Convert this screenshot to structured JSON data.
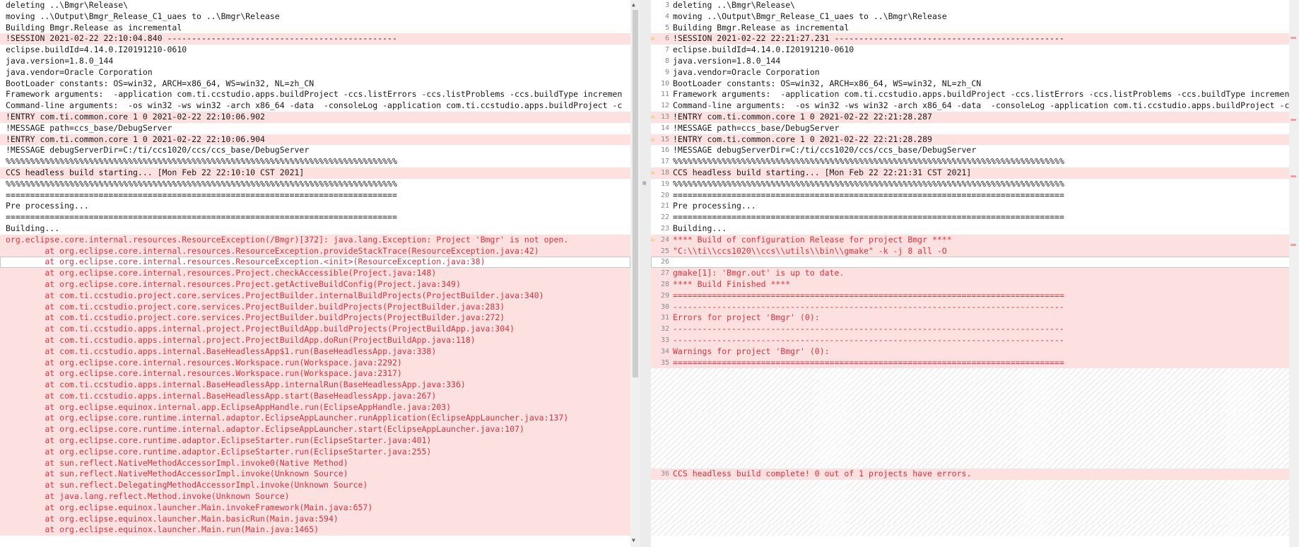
{
  "left_pane": {
    "lines": [
      {
        "text": "deleting ..\\Bmgr\\Release\\",
        "diff": false
      },
      {
        "text": "moving ..\\Output\\Bmgr_Release_C1_uaes to ..\\Bmgr\\Release",
        "diff": false
      },
      {
        "text": "Building Bmgr.Release as incremental",
        "diff": false
      },
      {
        "text": "!SESSION 2021-02-22 22:10:04.840 -----------------------------------------------",
        "diff": true
      },
      {
        "text": "eclipse.buildId=4.14.0.I20191210-0610",
        "diff": false
      },
      {
        "text": "java.version=1.8.0_144",
        "diff": false
      },
      {
        "text": "java.vendor=Oracle Corporation",
        "diff": false
      },
      {
        "text": "BootLoader constants: OS=win32, ARCH=x86_64, WS=win32, NL=zh_CN",
        "diff": false
      },
      {
        "text": "Framework arguments:  -application com.ti.ccstudio.apps.buildProject -ccs.listErrors -ccs.listProblems -ccs.buildType incremen",
        "diff": false
      },
      {
        "text": "Command-line arguments:  -os win32 -ws win32 -arch x86_64 -data  -consoleLog -application com.ti.ccstudio.apps.buildProject -c",
        "diff": false
      },
      {
        "text": "!ENTRY com.ti.common.core 1 0 2021-02-22 22:10:06.902",
        "diff": true
      },
      {
        "text": "!MESSAGE path=ccs_base/DebugServer",
        "diff": false
      },
      {
        "text": "!ENTRY com.ti.common.core 1 0 2021-02-22 22:10:06.904",
        "diff": true
      },
      {
        "text": "!MESSAGE debugServerDir=C:/ti/ccs1020/ccs/ccs_base/DebugServer",
        "diff": false
      },
      {
        "text": "%%%%%%%%%%%%%%%%%%%%%%%%%%%%%%%%%%%%%%%%%%%%%%%%%%%%%%%%%%%%%%%%%%%%%%%%%%%%%%%%",
        "diff": false
      },
      {
        "text": "CCS headless build starting... [Mon Feb 22 22:10:10 CST 2021]",
        "diff": true
      },
      {
        "text": "%%%%%%%%%%%%%%%%%%%%%%%%%%%%%%%%%%%%%%%%%%%%%%%%%%%%%%%%%%%%%%%%%%%%%%%%%%%%%%%%",
        "diff": false
      },
      {
        "text": "================================================================================",
        "diff": false
      },
      {
        "text": "Pre processing...",
        "diff": false
      },
      {
        "text": "================================================================================",
        "diff": false
      },
      {
        "text": "Building...",
        "diff": false
      },
      {
        "text": "org.eclipse.core.internal.resources.ResourceException(/Bmgr)[372]: java.lang.Exception: Project 'Bmgr' is not open.",
        "diff": true,
        "red": true
      },
      {
        "text": "\tat org.eclipse.core.internal.resources.ResourceException.provideStackTrace(ResourceException.java:42)",
        "diff": true,
        "red": true
      },
      {
        "text": "\tat org.eclipse.core.internal.resources.ResourceException.<init>(ResourceException.java:38)",
        "diff": false,
        "red": true,
        "cursor": true
      },
      {
        "text": "\tat org.eclipse.core.internal.resources.Project.checkAccessible(Project.java:148)",
        "diff": true,
        "red": true
      },
      {
        "text": "\tat org.eclipse.core.internal.resources.Project.getActiveBuildConfig(Project.java:349)",
        "diff": true,
        "red": true
      },
      {
        "text": "\tat com.ti.ccstudio.project.core.services.ProjectBuilder.internalBuildProjects(ProjectBuilder.java:340)",
        "diff": true,
        "red": true
      },
      {
        "text": "\tat com.ti.ccstudio.project.core.services.ProjectBuilder.buildProjects(ProjectBuilder.java:283)",
        "diff": true,
        "red": true
      },
      {
        "text": "\tat com.ti.ccstudio.project.core.services.ProjectBuilder.buildProjects(ProjectBuilder.java:272)",
        "diff": true,
        "red": true
      },
      {
        "text": "\tat com.ti.ccstudio.apps.internal.project.ProjectBuildApp.buildProjects(ProjectBuildApp.java:304)",
        "diff": true,
        "red": true
      },
      {
        "text": "\tat com.ti.ccstudio.apps.internal.project.ProjectBuildApp.doRun(ProjectBuildApp.java:118)",
        "diff": true,
        "red": true
      },
      {
        "text": "\tat com.ti.ccstudio.apps.internal.BaseHeadlessApp$1.run(BaseHeadlessApp.java:338)",
        "diff": true,
        "red": true
      },
      {
        "text": "\tat org.eclipse.core.internal.resources.Workspace.run(Workspace.java:2292)",
        "diff": true,
        "red": true
      },
      {
        "text": "\tat org.eclipse.core.internal.resources.Workspace.run(Workspace.java:2317)",
        "diff": true,
        "red": true
      },
      {
        "text": "\tat com.ti.ccstudio.apps.internal.BaseHeadlessApp.internalRun(BaseHeadlessApp.java:336)",
        "diff": true,
        "red": true
      },
      {
        "text": "\tat com.ti.ccstudio.apps.internal.BaseHeadlessApp.start(BaseHeadlessApp.java:267)",
        "diff": true,
        "red": true
      },
      {
        "text": "\tat org.eclipse.equinox.internal.app.EclipseAppHandle.run(EclipseAppHandle.java:203)",
        "diff": true,
        "red": true
      },
      {
        "text": "\tat org.eclipse.core.runtime.internal.adaptor.EclipseAppLauncher.runApplication(EclipseAppLauncher.java:137)",
        "diff": true,
        "red": true
      },
      {
        "text": "\tat org.eclipse.core.runtime.internal.adaptor.EclipseAppLauncher.start(EclipseAppLauncher.java:107)",
        "diff": true,
        "red": true
      },
      {
        "text": "\tat org.eclipse.core.runtime.adaptor.EclipseStarter.run(EclipseStarter.java:401)",
        "diff": true,
        "red": true
      },
      {
        "text": "\tat org.eclipse.core.runtime.adaptor.EclipseStarter.run(EclipseStarter.java:255)",
        "diff": true,
        "red": true
      },
      {
        "text": "\tat sun.reflect.NativeMethodAccessorImpl.invoke0(Native Method)",
        "diff": true,
        "red": true
      },
      {
        "text": "\tat sun.reflect.NativeMethodAccessorImpl.invoke(Unknown Source)",
        "diff": true,
        "red": true
      },
      {
        "text": "\tat sun.reflect.DelegatingMethodAccessorImpl.invoke(Unknown Source)",
        "diff": true,
        "red": true
      },
      {
        "text": "\tat java.lang.reflect.Method.invoke(Unknown Source)",
        "diff": true,
        "red": true
      },
      {
        "text": "\tat org.eclipse.equinox.launcher.Main.invokeFramework(Main.java:657)",
        "diff": true,
        "red": true
      },
      {
        "text": "\tat org.eclipse.equinox.launcher.Main.basicRun(Main.java:594)",
        "diff": true,
        "red": true
      },
      {
        "text": "\tat org.eclipse.equinox.launcher.Main.run(Main.java:1465)",
        "diff": true,
        "red": true
      }
    ]
  },
  "right_pane": {
    "lines": [
      {
        "num": "3",
        "text": "deleting ..\\Bmgr\\Release\\",
        "diff": false
      },
      {
        "num": "4",
        "text": "moving ..\\Output\\Bmgr_Release_C1_uaes to ..\\Bmgr\\Release",
        "diff": false
      },
      {
        "num": "5",
        "text": "Building Bmgr.Release as incremental",
        "diff": false
      },
      {
        "num": "6",
        "text": "!SESSION 2021-02-22 22:21:27.231 -----------------------------------------------",
        "diff": true,
        "arrow": true
      },
      {
        "num": "7",
        "text": "eclipse.buildId=4.14.0.I20191210-0610",
        "diff": false
      },
      {
        "num": "8",
        "text": "java.version=1.8.0_144",
        "diff": false
      },
      {
        "num": "9",
        "text": "java.vendor=Oracle Corporation",
        "diff": false
      },
      {
        "num": "10",
        "text": "BootLoader constants: OS=win32, ARCH=x86_64, WS=win32, NL=zh_CN",
        "diff": false
      },
      {
        "num": "11",
        "text": "Framework arguments:  -application com.ti.ccstudio.apps.buildProject -ccs.listErrors -ccs.listProblems -ccs.buildType incremen",
        "diff": false
      },
      {
        "num": "12",
        "text": "Command-line arguments:  -os win32 -ws win32 -arch x86_64 -data  -consoleLog -application com.ti.ccstudio.apps.buildProject -c",
        "diff": false
      },
      {
        "num": "13",
        "text": "!ENTRY com.ti.common.core 1 0 2021-02-22 22:21:28.287",
        "diff": true,
        "arrow": true
      },
      {
        "num": "14",
        "text": "!MESSAGE path=ccs_base/DebugServer",
        "diff": false
      },
      {
        "num": "15",
        "text": "!ENTRY com.ti.common.core 1 0 2021-02-22 22:21:28.289",
        "diff": true,
        "arrow": true
      },
      {
        "num": "16",
        "text": "!MESSAGE debugServerDir=C:/ti/ccs1020/ccs/ccs_base/DebugServer",
        "diff": false
      },
      {
        "num": "17",
        "text": "%%%%%%%%%%%%%%%%%%%%%%%%%%%%%%%%%%%%%%%%%%%%%%%%%%%%%%%%%%%%%%%%%%%%%%%%%%%%%%%%",
        "diff": false
      },
      {
        "num": "18",
        "text": "CCS headless build starting... [Mon Feb 22 22:21:31 CST 2021]",
        "diff": true,
        "arrow": true
      },
      {
        "num": "19",
        "text": "%%%%%%%%%%%%%%%%%%%%%%%%%%%%%%%%%%%%%%%%%%%%%%%%%%%%%%%%%%%%%%%%%%%%%%%%%%%%%%%%",
        "diff": false
      },
      {
        "num": "20",
        "text": "================================================================================",
        "diff": false
      },
      {
        "num": "21",
        "text": "Pre processing...",
        "diff": false
      },
      {
        "num": "22",
        "text": "================================================================================",
        "diff": false
      },
      {
        "num": "23",
        "text": "Building...",
        "diff": false
      },
      {
        "num": "24",
        "text": "**** Build of configuration Release for project Bmgr ****",
        "diff": true,
        "red": true,
        "arrow": true
      },
      {
        "num": "25",
        "text": "\"C:\\\\ti\\\\ccs1020\\\\ccs\\\\utils\\\\bin\\\\gmake\" -k -j 8 all -O",
        "diff": true,
        "red": true
      },
      {
        "num": "26",
        "text": "",
        "diff": false,
        "cursor": true
      },
      {
        "num": "27",
        "text": "gmake[1]: 'Bmgr.out' is up to date.",
        "diff": true,
        "red": true
      },
      {
        "num": "28",
        "text": "**** Build Finished ****",
        "diff": true,
        "red": true
      },
      {
        "num": "29",
        "text": "================================================================================",
        "diff": true,
        "red": true
      },
      {
        "num": "30",
        "text": "--------------------------------------------------------------------------------",
        "diff": true,
        "red": true
      },
      {
        "num": "31",
        "text": "Errors for project 'Bmgr' (0):",
        "diff": true,
        "red": true
      },
      {
        "num": "32",
        "text": "--------------------------------------------------------------------------------",
        "diff": true,
        "red": true
      },
      {
        "num": "33",
        "text": "--------------------------------------------------------------------------------",
        "diff": true,
        "red": true
      },
      {
        "num": "34",
        "text": "Warnings for project 'Bmgr' (0):",
        "diff": true,
        "red": true
      },
      {
        "num": "35",
        "text": "================================================================================",
        "diff": true,
        "red": true
      },
      {
        "num": "",
        "text": "",
        "diff": false,
        "hatch": true
      },
      {
        "num": "",
        "text": "",
        "diff": false,
        "hatch": true
      },
      {
        "num": "",
        "text": "",
        "diff": false,
        "hatch": true
      },
      {
        "num": "",
        "text": "",
        "diff": false,
        "hatch": true
      },
      {
        "num": "",
        "text": "",
        "diff": false,
        "hatch": true
      },
      {
        "num": "",
        "text": "",
        "diff": false,
        "hatch": true
      },
      {
        "num": "",
        "text": "",
        "diff": false,
        "hatch": true
      },
      {
        "num": "",
        "text": "",
        "diff": false,
        "hatch": true
      },
      {
        "num": "",
        "text": "",
        "diff": false,
        "hatch": true
      },
      {
        "num": "36",
        "text": "CCS headless build complete! 0 out of 1 projects have errors.",
        "diff": true,
        "red": true
      },
      {
        "num": "",
        "text": "",
        "diff": false,
        "hatch": true
      },
      {
        "num": "",
        "text": "",
        "diff": false,
        "hatch": true
      },
      {
        "num": "",
        "text": "",
        "diff": false,
        "hatch": true
      },
      {
        "num": "",
        "text": "",
        "diff": false,
        "hatch": true
      },
      {
        "num": "",
        "text": "",
        "diff": false,
        "hatch": true
      }
    ]
  },
  "icons": {
    "diff_arrow": "arrow-left-icon",
    "splitter_grip": "grip-icon"
  },
  "colors": {
    "diff_bg": "#fde1e1",
    "diff_text": "#e0323e",
    "arrow": "#e3b800"
  }
}
